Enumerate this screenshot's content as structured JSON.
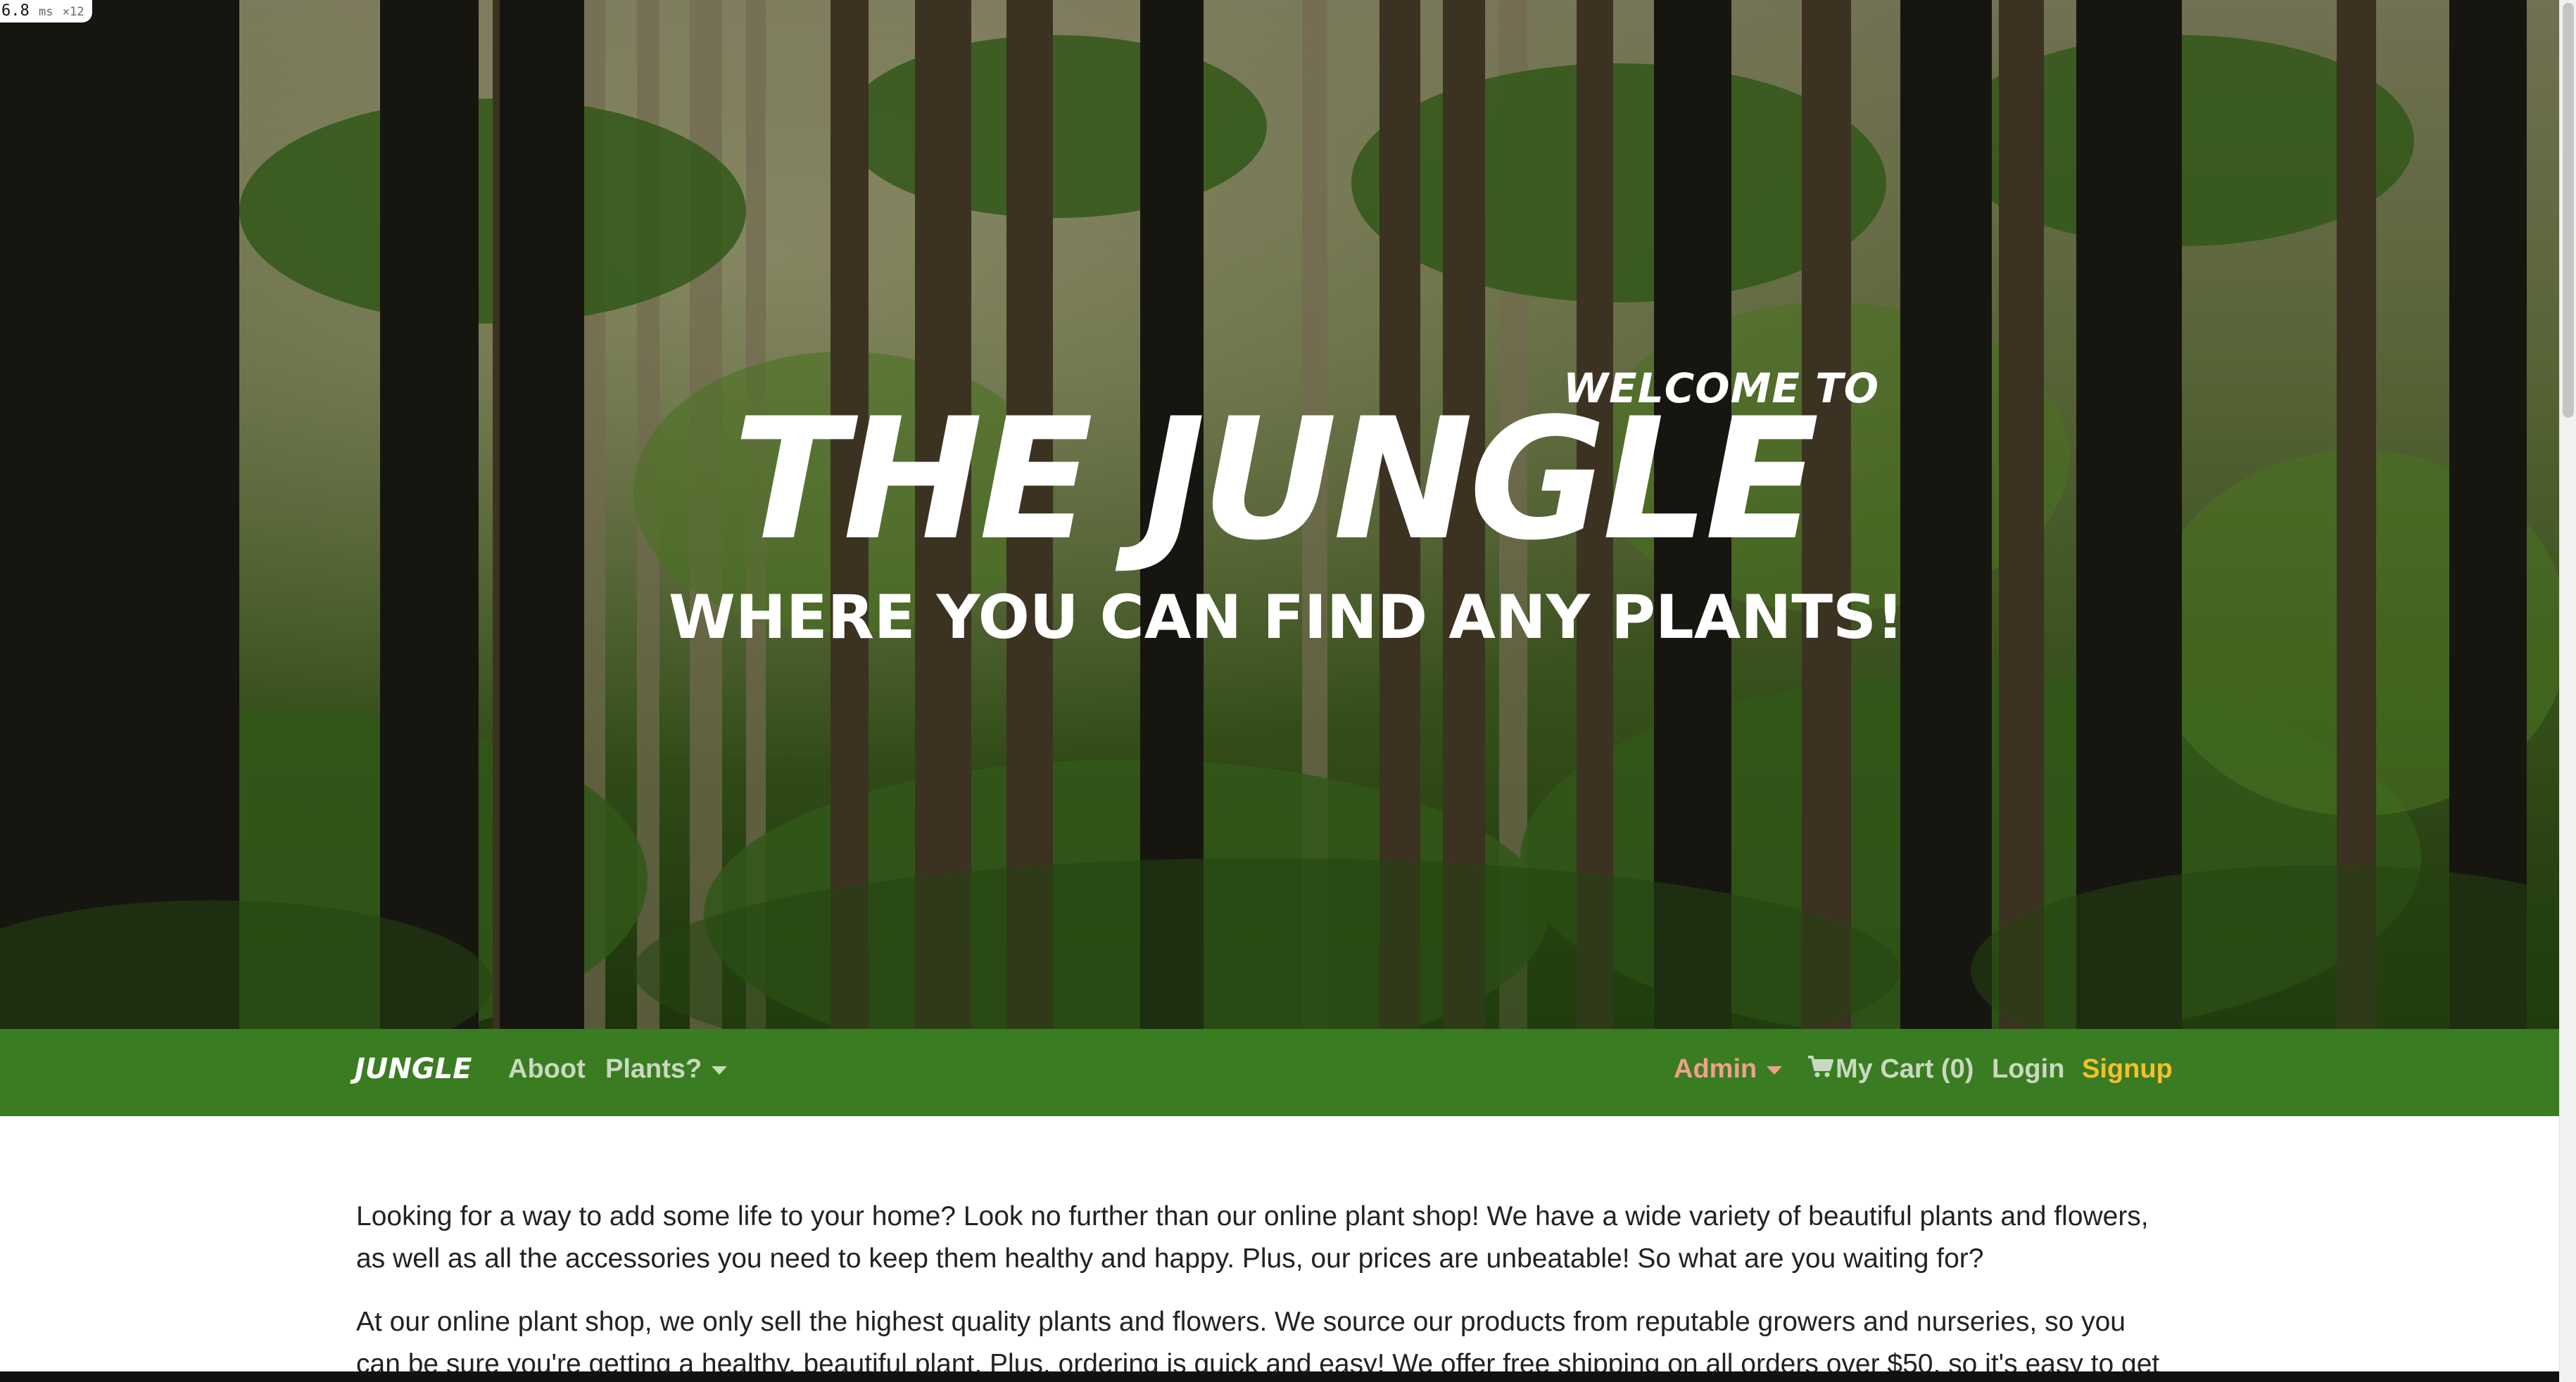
{
  "perf_badge": {
    "value": "6.8",
    "unit": "ms",
    "multiplier": "×12"
  },
  "hero": {
    "welcome": "WELCOME TO",
    "title": "THE JUNGLE",
    "subtitle": "WHERE YOU CAN FIND ANY PLANTS!"
  },
  "navbar": {
    "brand": "JUNGLE",
    "links": {
      "about": "Aboot",
      "plants": "Plants?",
      "admin": "Admin",
      "cart": "My Cart (0)",
      "login": "Login",
      "signup": "Signup"
    },
    "colors": {
      "background": "#3a7c22",
      "link": "#c9d9c0",
      "admin": "#f0a08a",
      "signup": "#f5c02a"
    }
  },
  "content": {
    "paragraphs": [
      "Looking for a way to add some life to your home? Look no further than our online plant shop! We have a wide variety of beautiful plants and flowers, as well as all the accessories you need to keep them healthy and happy. Plus, our prices are unbeatable! So what are you waiting for?",
      "At our online plant shop, we only sell the highest quality plants and flowers. We source our products from reputable growers and nurseries, so you can be sure you're getting a healthy, beautiful plant. Plus, ordering is quick and easy! We offer free shipping on all orders over $50, so it's easy to get the plants you"
    ]
  },
  "icons": {
    "cart": "shopping-cart-icon",
    "dropdown": "caret-down-icon"
  }
}
